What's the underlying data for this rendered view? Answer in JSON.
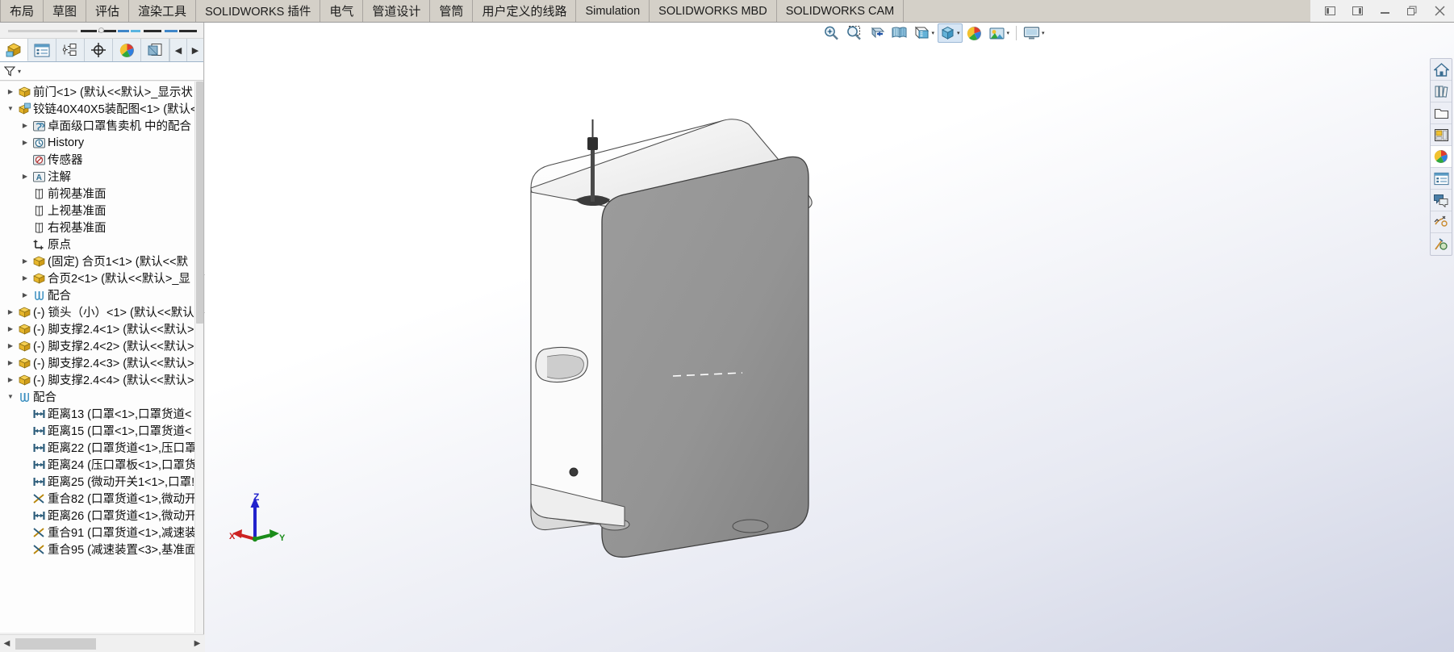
{
  "window": {
    "controls": [
      {
        "name": "restore-left-icon",
        "glyph": "left-pane"
      },
      {
        "name": "restore-right-icon",
        "glyph": "right-pane"
      },
      {
        "name": "minimize-icon",
        "glyph": "minimize"
      },
      {
        "name": "restore-icon",
        "glyph": "restore"
      },
      {
        "name": "close-icon",
        "glyph": "close"
      }
    ]
  },
  "ribbon": {
    "tabs": [
      {
        "label": "布局",
        "latin": false,
        "partial": true
      },
      {
        "label": "草图",
        "latin": false
      },
      {
        "label": "评估",
        "latin": false
      },
      {
        "label": "渲染工具",
        "latin": false
      },
      {
        "label": "SOLIDWORKS 插件",
        "latin": true
      },
      {
        "label": "电气",
        "latin": false
      },
      {
        "label": "管道设计",
        "latin": false
      },
      {
        "label": "管筒",
        "latin": false
      },
      {
        "label": "用户定义的线路",
        "latin": false
      },
      {
        "label": "Simulation",
        "latin": true
      },
      {
        "label": "SOLIDWORKS MBD",
        "latin": true
      },
      {
        "label": "SOLIDWORKS CAM",
        "latin": true
      }
    ]
  },
  "left_panel": {
    "tab_icons": [
      {
        "name": "feature-manager-tab",
        "icon": "yellow-cube-icon",
        "active": true
      },
      {
        "name": "property-manager-tab",
        "icon": "property-list-icon",
        "active": false
      },
      {
        "name": "configuration-manager-tab",
        "icon": "configuration-icon",
        "active": false
      },
      {
        "name": "dimxpert-manager-tab",
        "icon": "crosshair-icon",
        "active": false
      },
      {
        "name": "display-manager-tab",
        "icon": "color-ball-icon",
        "active": false
      },
      {
        "name": "addins-tab",
        "icon": "overlay-pages-icon",
        "active": false
      }
    ],
    "nav_prev": "◀",
    "nav_next": "▶",
    "filter": {
      "name": "filter-icon",
      "caret": "▾"
    },
    "tree": [
      {
        "indent": 0,
        "expander": "collapsed",
        "icon": "part-icon",
        "label": "前门<1> (默认<<默认>_显示状"
      },
      {
        "indent": 0,
        "expander": "expanded",
        "icon": "assembly-icon",
        "label": "铰链40X40X5装配图<1> (默认<"
      },
      {
        "indent": 1,
        "expander": "collapsed",
        "icon": "mates-folder-icon",
        "label": "卓面级口罩售卖机 中的配合"
      },
      {
        "indent": 1,
        "expander": "collapsed",
        "icon": "history-icon",
        "label": "History"
      },
      {
        "indent": 1,
        "expander": "none",
        "icon": "sensor-icon",
        "label": "传感器"
      },
      {
        "indent": 1,
        "expander": "collapsed",
        "icon": "annotation-icon",
        "label": "注解"
      },
      {
        "indent": 1,
        "expander": "none",
        "icon": "plane-icon",
        "label": "前视基准面"
      },
      {
        "indent": 1,
        "expander": "none",
        "icon": "plane-icon",
        "label": "上视基准面"
      },
      {
        "indent": 1,
        "expander": "none",
        "icon": "plane-icon",
        "label": "右视基准面"
      },
      {
        "indent": 1,
        "expander": "none",
        "icon": "origin-icon",
        "label": "原点"
      },
      {
        "indent": 1,
        "expander": "collapsed",
        "icon": "part-icon",
        "label": "(固定) 合页1<1> (默认<<默"
      },
      {
        "indent": 1,
        "expander": "collapsed",
        "icon": "part-icon",
        "label": "合页2<1> (默认<<默认>_显"
      },
      {
        "indent": 1,
        "expander": "collapsed",
        "icon": "paperclip-icon",
        "label": "配合"
      },
      {
        "indent": 0,
        "expander": "collapsed",
        "icon": "part-icon",
        "label": "(-) 锁头（小）<1> (默认<<默认"
      },
      {
        "indent": 0,
        "expander": "collapsed",
        "icon": "part-icon",
        "label": "(-) 脚支撑2.4<1> (默认<<默认>"
      },
      {
        "indent": 0,
        "expander": "collapsed",
        "icon": "part-icon",
        "label": "(-) 脚支撑2.4<2> (默认<<默认>"
      },
      {
        "indent": 0,
        "expander": "collapsed",
        "icon": "part-icon",
        "label": "(-) 脚支撑2.4<3> (默认<<默认>"
      },
      {
        "indent": 0,
        "expander": "collapsed",
        "icon": "part-icon",
        "label": "(-) 脚支撑2.4<4> (默认<<默认>"
      },
      {
        "indent": 0,
        "expander": "expanded",
        "icon": "paperclip-icon",
        "label": "配合"
      },
      {
        "indent": 1,
        "expander": "none",
        "icon": "distance-icon",
        "label": "距离13 (口罩<1>,口罩货道<"
      },
      {
        "indent": 1,
        "expander": "none",
        "icon": "distance-icon",
        "label": "距离15 (口罩<1>,口罩货道<"
      },
      {
        "indent": 1,
        "expander": "none",
        "icon": "distance-icon",
        "label": "距离22 (口罩货道<1>,压口罩"
      },
      {
        "indent": 1,
        "expander": "none",
        "icon": "distance-icon",
        "label": "距离24 (压口罩板<1>,口罩货"
      },
      {
        "indent": 1,
        "expander": "none",
        "icon": "distance-icon",
        "label": "距离25 (微动开关1<1>,口罩!"
      },
      {
        "indent": 1,
        "expander": "none",
        "icon": "coincident-icon",
        "label": "重合82 (口罩货道<1>,微动开"
      },
      {
        "indent": 1,
        "expander": "none",
        "icon": "distance-icon",
        "label": "距离26 (口罩货道<1>,微动开"
      },
      {
        "indent": 1,
        "expander": "none",
        "icon": "coincident-icon",
        "label": "重合91 (口罩货道<1>,减速装"
      },
      {
        "indent": 1,
        "expander": "none",
        "icon": "coincident-icon",
        "label": "重合95 (减速装置<3>,基准面"
      }
    ],
    "hscroll": {
      "left_arrow": "◀",
      "right_arrow": "▶"
    }
  },
  "viewport": {
    "tools": [
      {
        "name": "zoom-to-fit-button",
        "icon": "magnifier-fit-icon",
        "caret": false,
        "boxed": false
      },
      {
        "name": "zoom-to-area-button",
        "icon": "magnifier-area-icon",
        "caret": false,
        "boxed": false
      },
      {
        "name": "section-view-button",
        "icon": "section-view-icon",
        "caret": false,
        "boxed": false
      },
      {
        "name": "view-orientation-button",
        "icon": "view-orientation-icon",
        "caret": false,
        "boxed": false
      },
      {
        "name": "display-style-button",
        "icon": "display-style-icon",
        "caret": true,
        "boxed": false
      },
      {
        "name": "hide-show-items-button",
        "icon": "glasses-cube-icon",
        "caret": true,
        "boxed": true
      },
      {
        "name": "edit-appearance-button",
        "icon": "appearance-ball-icon",
        "caret": false,
        "boxed": false
      },
      {
        "name": "apply-scene-button",
        "icon": "scene-icon",
        "caret": true,
        "boxed": false
      },
      {
        "name": "view-settings-button",
        "icon": "monitor-icon",
        "caret": true,
        "boxed": false
      }
    ]
  },
  "right_toolbar": [
    {
      "name": "home-icon",
      "active": false
    },
    {
      "name": "design-library-icon",
      "active": false
    },
    {
      "name": "file-explorer-icon",
      "active": false
    },
    {
      "name": "view-palette-icon",
      "active": false
    },
    {
      "name": "appearances-scenes-icon",
      "active": true
    },
    {
      "name": "custom-properties-icon",
      "active": false
    },
    {
      "name": "solidworks-forum-icon",
      "active": false
    },
    {
      "name": "drawing-views-icon",
      "active": false
    },
    {
      "name": "search-tools-icon",
      "active": false
    }
  ],
  "triad": {
    "z_label": "Z",
    "x_label": "X",
    "y_label": "Y",
    "colors": {
      "z": "#2222cc",
      "x": "#cc2222",
      "y": "#1a8c1a"
    }
  }
}
